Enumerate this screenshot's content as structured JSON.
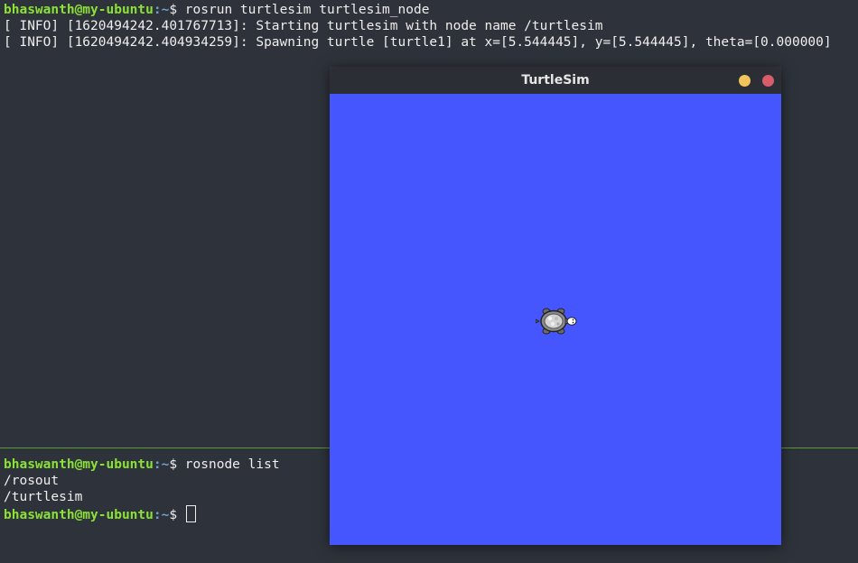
{
  "terminal_top": {
    "prompt_user": "bhaswanth@my-ubuntu",
    "prompt_path": ":~",
    "prompt_dollar": "$",
    "command": " rosrun turtlesim turtlesim_node",
    "log_lines": [
      "[ INFO] [1620494242.401767713]: Starting turtlesim with node name /turtlesim",
      "[ INFO] [1620494242.404934259]: Spawning turtle [turtle1] at x=[5.544445], y=[5.544445], theta=[0.000000]"
    ]
  },
  "terminal_bottom": {
    "prompt_user": "bhaswanth@my-ubuntu",
    "prompt_path": ":~",
    "prompt_dollar": "$",
    "command": " rosnode list",
    "output_lines": [
      "/rosout",
      "/turtlesim"
    ],
    "current_prompt_user": "bhaswanth@my-ubuntu",
    "current_prompt_path": ":~",
    "current_prompt_dollar": "$",
    "current_input": " "
  },
  "turtlesim_window": {
    "title": "TurtleSim",
    "canvas_color": "#4556ff",
    "turtle_icon": "turtle-icon",
    "minimize_color": "#f2c55c",
    "close_color": "#d95c6a"
  },
  "colors": {
    "terminal_background": "#2e333b",
    "prompt_user": "#8ae234",
    "prompt_path": "#729fcf",
    "split_divider": "#5e9d36"
  }
}
